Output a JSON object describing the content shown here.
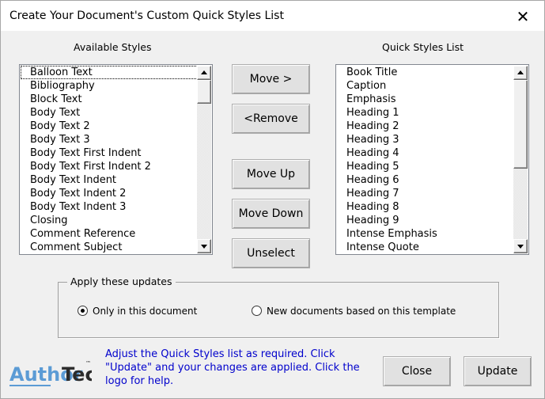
{
  "window": {
    "title": "Create Your Document's Custom Quick Styles List",
    "close_glyph": "✕"
  },
  "available": {
    "label": "Available Styles",
    "items": [
      "Balloon Text",
      "Bibliography",
      "Block Text",
      "Body Text",
      "Body Text 2",
      "Body Text 3",
      "Body Text First Indent",
      "Body Text First Indent 2",
      "Body Text Indent",
      "Body Text Indent 2",
      "Body Text Indent 3",
      "Closing",
      "Comment Reference",
      "Comment Subject"
    ]
  },
  "quick": {
    "label": "Quick Styles List",
    "items": [
      "Book Title",
      "Caption",
      "Emphasis",
      "Heading 1",
      "Heading 2",
      "Heading 3",
      "Heading 4",
      "Heading 5",
      "Heading 6",
      "Heading 7",
      "Heading 8",
      "Heading 9",
      "Intense Emphasis",
      "Intense Quote"
    ]
  },
  "buttons": {
    "move": "Move >",
    "remove": "<Remove",
    "move_up": "Move Up",
    "move_down": "Move Down",
    "unselect": "Unselect",
    "close": "Close",
    "update": "Update"
  },
  "apply_group": {
    "legend": "Apply these updates",
    "option_document": "Only in this document",
    "option_template": "New documents based on this template",
    "selected": "document"
  },
  "logo": {
    "text_a": "Author",
    "text_b": "Tec",
    "tm": "™",
    "color_a": "#5b9bd5",
    "color_b": "#2b2b2b"
  },
  "help": {
    "text": "Adjust the Quick Styles list as required. Click \"Update\" and your changes are applied. Click the logo for help."
  },
  "icons": {
    "scroll_up": "triangle-up-icon",
    "scroll_down": "triangle-down-icon",
    "close": "close-icon"
  }
}
